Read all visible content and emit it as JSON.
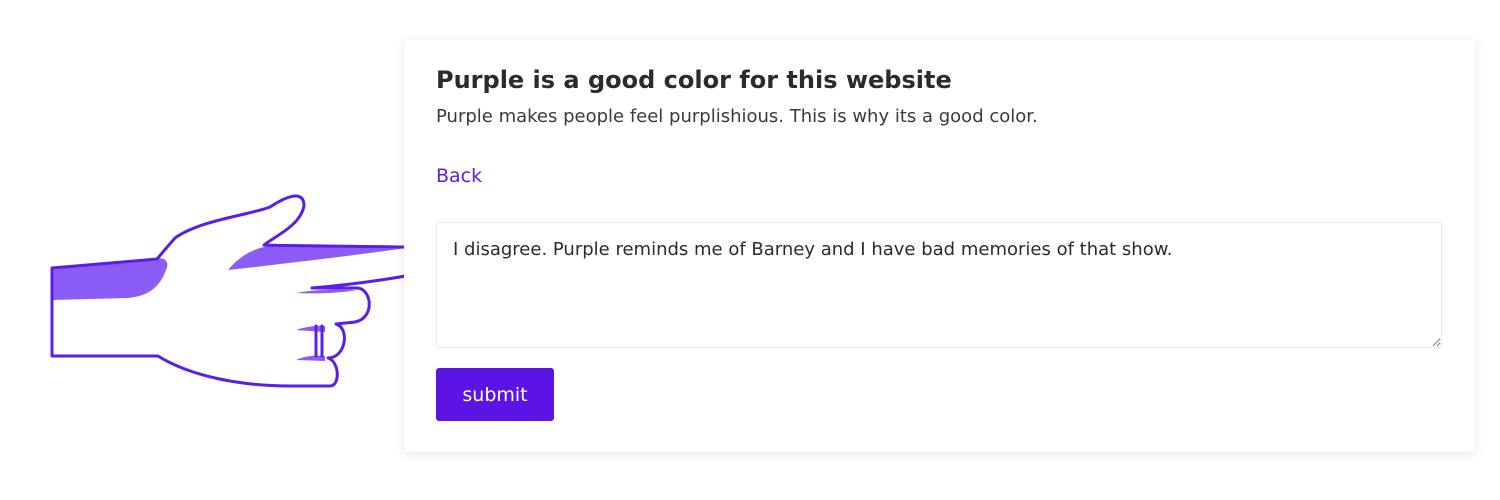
{
  "colors": {
    "accent": "#5b14e4",
    "link": "#5b1ee6",
    "hand_fill": "#8b5cf6",
    "hand_outline": "#5b1ee6"
  },
  "decoration": {
    "icon": "pointing-hand-icon"
  },
  "post": {
    "title": "Purple is a good color for this website",
    "subtitle": "Purple makes people feel purplishious. This is why its a good color."
  },
  "nav": {
    "back_label": "Back"
  },
  "reply": {
    "value": "I disagree. Purple reminds me of Barney and I have bad memories of that show.",
    "placeholder": ""
  },
  "form": {
    "submit_label": "submit"
  }
}
